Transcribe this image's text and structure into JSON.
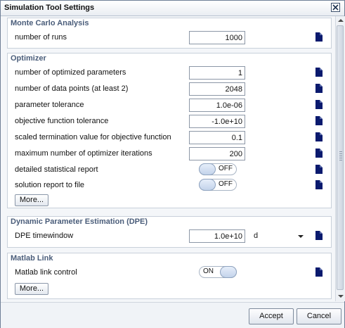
{
  "window": {
    "title": "Simulation Tool Settings"
  },
  "sections": {
    "monte_carlo": {
      "title": "Monte Carlo Analysis",
      "number_of_runs": {
        "label": "number of runs",
        "value": "1000"
      }
    },
    "optimizer": {
      "title": "Optimizer",
      "rows": [
        {
          "label": "number of optimized parameters",
          "value": "1"
        },
        {
          "label": "number of data points (at least 2)",
          "value": "2048"
        },
        {
          "label": "parameter tolerance",
          "value": "1.0e-06"
        },
        {
          "label": "objective function tolerance",
          "value": "-1.0e+10"
        },
        {
          "label": "scaled termination value for objective function",
          "value": "0.1"
        },
        {
          "label": "maximum number of optimizer iterations",
          "value": "200"
        }
      ],
      "detailed_report": {
        "label": "detailed statistical report",
        "state": "OFF"
      },
      "solution_report": {
        "label": "solution report to file",
        "state": "OFF"
      },
      "more_label": "More..."
    },
    "dpe": {
      "title": "Dynamic Parameter Estimation (DPE)",
      "timewindow": {
        "label": "DPE timewindow",
        "value": "1.0e+10",
        "unit": "d"
      }
    },
    "matlab": {
      "title": "Matlab Link",
      "link_control": {
        "label": "Matlab link control",
        "state": "ON"
      },
      "more_label": "More..."
    }
  },
  "footer": {
    "accept_label": "Accept",
    "cancel_label": "Cancel"
  },
  "colors": {
    "section_title": "#4a5d7a",
    "doc_icon": "#0a1a6e",
    "window_border": "#6f7f96"
  },
  "icons": {
    "close": "close-icon",
    "field_help": "document-icon"
  }
}
